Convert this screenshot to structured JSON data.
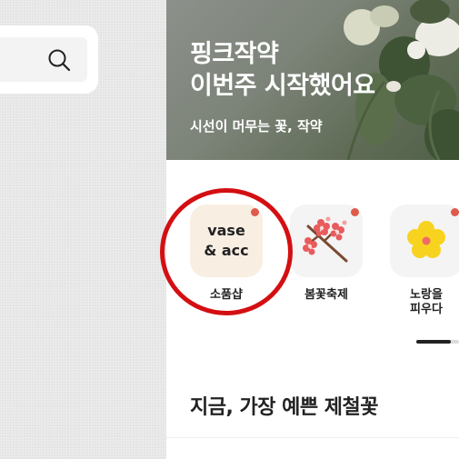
{
  "banner": {
    "title_line1": "핑크작약",
    "title_line2": "이번주 시작했어요",
    "subtitle": "시선이 머무는 꽃, 작약"
  },
  "categories": [
    {
      "tile_line1": "vase",
      "tile_line2": "& acc",
      "label": "소품샵",
      "icon": "vase-acc-text"
    },
    {
      "label": "봄꽃축제",
      "icon": "cherry-blossom-branch-icon"
    },
    {
      "label_line1": "노랑을",
      "label_line2": "피우다",
      "icon": "yellow-flower-icon"
    }
  ],
  "section": {
    "title": "지금, 가장 예쁜 제철꽃"
  },
  "colors": {
    "notify_dot": "#e05a4b",
    "highlight_circle": "#d40f12",
    "vase_tile": "#f8eee2"
  }
}
